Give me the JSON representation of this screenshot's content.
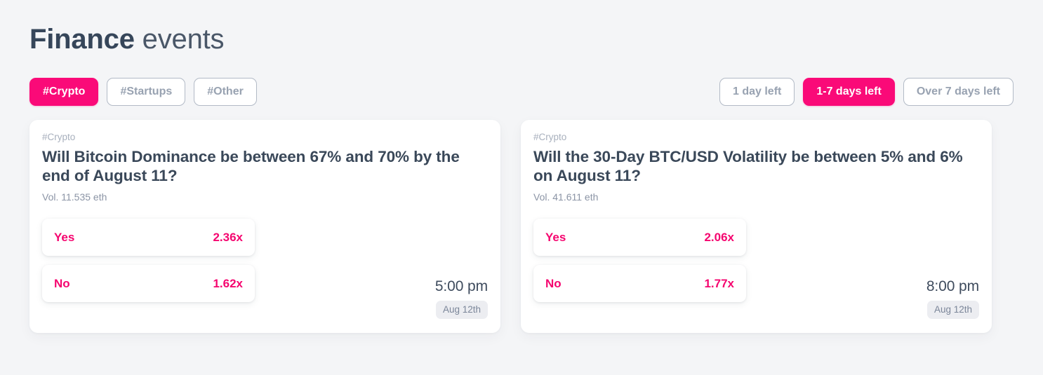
{
  "header": {
    "title_strong": "Finance",
    "title_light": " events"
  },
  "filters": {
    "categories": [
      {
        "label": "#Crypto",
        "active": true
      },
      {
        "label": "#Startups",
        "active": false
      },
      {
        "label": "#Other",
        "active": false
      }
    ],
    "timeframes": [
      {
        "label": "1 day left",
        "active": false
      },
      {
        "label": "1-7 days left",
        "active": true
      },
      {
        "label": "Over 7 days left",
        "active": false
      }
    ]
  },
  "colors": {
    "accent": "#fa0a78",
    "accent_text": "#f5056f",
    "page_bg": "#f4f5f7",
    "card_bg": "#ffffff",
    "title": "#36465a",
    "muted": "#8b94a5",
    "chip_inactive_border": "#b2bac6",
    "chip_inactive_text": "#98a2b1",
    "date_badge_bg": "#ecedf1"
  },
  "cards": [
    {
      "tag": "#Crypto",
      "title": "Will Bitcoin Dominance be between 67% and 70% by the end of August 11?",
      "volume": "Vol. 11.535 eth",
      "outcomes": [
        {
          "label": "Yes",
          "odds": "2.36x"
        },
        {
          "label": "No",
          "odds": "1.62x"
        }
      ],
      "time": "5:00 pm",
      "date": "Aug 12th"
    },
    {
      "tag": "#Crypto",
      "title": "Will the 30-Day BTC/USD Volatility be between 5% and 6% on August 11?",
      "volume": "Vol. 41.611 eth",
      "outcomes": [
        {
          "label": "Yes",
          "odds": "2.06x"
        },
        {
          "label": "No",
          "odds": "1.77x"
        }
      ],
      "time": "8:00 pm",
      "date": "Aug 12th"
    }
  ]
}
